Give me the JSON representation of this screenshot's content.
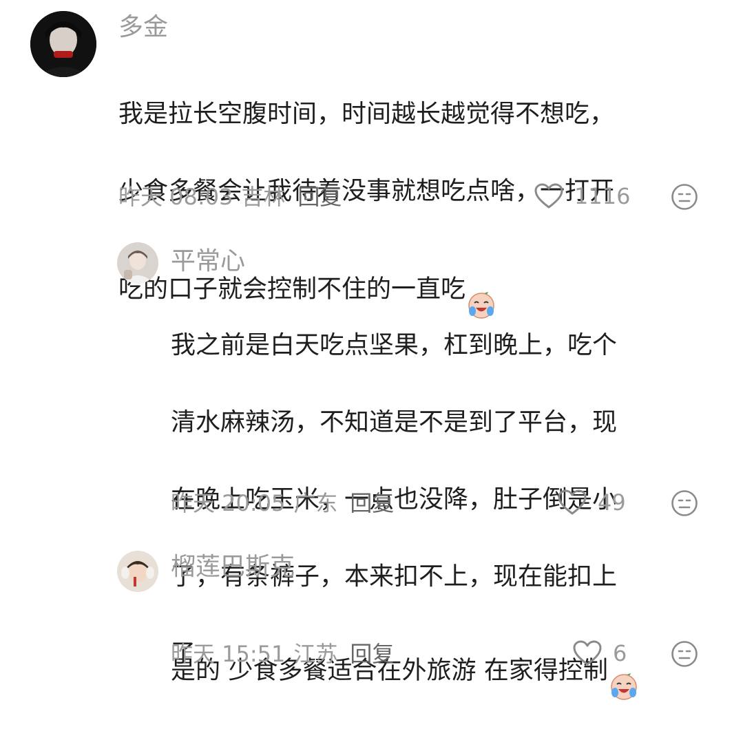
{
  "comments": [
    {
      "username": "多金",
      "text_lines": [
        "我是拉长空腹时间，时间越长越觉得不想吃，",
        "少食多餐会让我待着没事就想吃点啥，一打开",
        "吃的口子就会控制不住的一直吃"
      ],
      "trailing_emoji": "crying-laughing-face-emoji",
      "time": "昨天 08:03",
      "location": "吉林",
      "reply_label": "回复",
      "likes": "1116"
    },
    {
      "username": "平常心",
      "text_lines": [
        "我之前是白天吃点坚果，杠到晚上，吃个",
        "清水麻辣汤，不知道是不是到了平台，现",
        "在晚上吃玉米，一点也没降，肚子倒是小",
        "了，有条裤子，本来扣不上，现在能扣上",
        "了"
      ],
      "time": "昨天 20:05",
      "location": "广东",
      "reply_label": "回复",
      "likes": "49"
    },
    {
      "username": "榴莲巴斯克",
      "text_lines": [
        "是的 少食多餐适合在外旅游 在家得控制"
      ],
      "trailing_emoji": "crying-laughing-face-emoji",
      "time": "昨天 15:51",
      "location": "江苏",
      "reply_label": "回复",
      "likes": "6"
    }
  ],
  "icons": {
    "like": "heart-outline-icon",
    "dislike": "neutral-face-icon"
  },
  "colors": {
    "username": "#9a9a9a",
    "body": "#1e1e1e",
    "meta": "#9a9a9a",
    "reply": "#666666"
  }
}
